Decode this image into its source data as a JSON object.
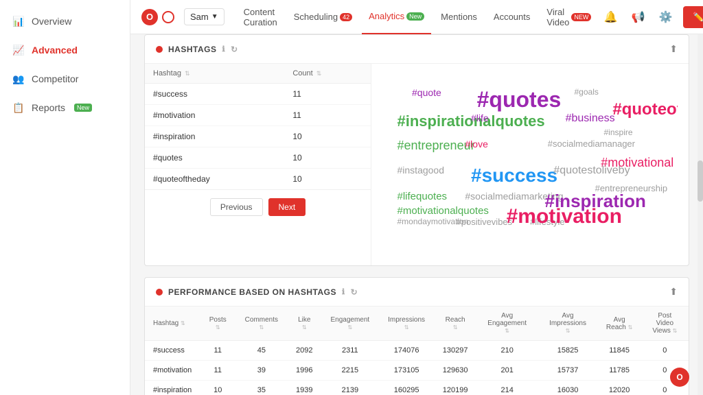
{
  "sidebar": {
    "items": [
      {
        "id": "overview",
        "label": "Overview",
        "icon": "📊",
        "active": false
      },
      {
        "id": "advanced",
        "label": "Advanced",
        "icon": "📈",
        "active": true
      },
      {
        "id": "competitor",
        "label": "Competitor",
        "icon": "👥",
        "active": false
      },
      {
        "id": "reports",
        "label": "Reports",
        "icon": "📋",
        "active": false,
        "badge": "New"
      }
    ]
  },
  "topnav": {
    "account": "Sam",
    "items": [
      {
        "id": "content-curation",
        "label": "Content Curation",
        "active": false
      },
      {
        "id": "scheduling",
        "label": "Scheduling",
        "active": false,
        "badge": "42"
      },
      {
        "id": "analytics",
        "label": "Analytics",
        "active": true,
        "badge": "New"
      },
      {
        "id": "mentions",
        "label": "Mentions",
        "active": false
      },
      {
        "id": "accounts",
        "label": "Accounts",
        "active": false
      },
      {
        "id": "viral-video",
        "label": "Viral Video",
        "active": false,
        "badge": "NEW"
      }
    ],
    "compose_label": "Compose"
  },
  "hashtags_card": {
    "title": "HASHTAGS",
    "table": {
      "columns": [
        "Hashtag",
        "Count"
      ],
      "rows": [
        {
          "hashtag": "#success",
          "count": "11"
        },
        {
          "hashtag": "#motivation",
          "count": "11"
        },
        {
          "hashtag": "#inspiration",
          "count": "10"
        },
        {
          "hashtag": "#quotes",
          "count": "10"
        },
        {
          "hashtag": "#quoteoftheday",
          "count": "10"
        }
      ]
    },
    "pagination": {
      "prev": "Previous",
      "next": "Next"
    },
    "wordcloud": [
      {
        "word": "#quote",
        "size": 14,
        "color": "#9c27b0"
      },
      {
        "word": "#quotes",
        "size": 32,
        "color": "#9c27b0"
      },
      {
        "word": "#goals",
        "size": 12,
        "color": "#9e9e9e"
      },
      {
        "word": "#inspirationalquotes",
        "size": 22,
        "color": "#4caf50"
      },
      {
        "word": "#life",
        "size": 14,
        "color": "#9c27b0"
      },
      {
        "word": "#business",
        "size": 16,
        "color": "#9c27b0"
      },
      {
        "word": "#entrepreneur",
        "size": 18,
        "color": "#4caf50"
      },
      {
        "word": "#love",
        "size": 14,
        "color": "#e91e63"
      },
      {
        "word": "#socialmediamanager",
        "size": 13,
        "color": "#9e9e9e"
      },
      {
        "word": "#instagood",
        "size": 14,
        "color": "#9e9e9e"
      },
      {
        "word": "#success",
        "size": 28,
        "color": "#2196f3"
      },
      {
        "word": "#quotestoliveby",
        "size": 16,
        "color": "#9e9e9e"
      },
      {
        "word": "#lifequotes",
        "size": 15,
        "color": "#4caf50"
      },
      {
        "word": "#socialmediamarketing",
        "size": 14,
        "color": "#9e9e9e"
      },
      {
        "word": "#inspiration",
        "size": 26,
        "color": "#9c27b0"
      },
      {
        "word": "#mondaymotivation",
        "size": 12,
        "color": "#9e9e9e"
      },
      {
        "word": "#positivevibes",
        "size": 13,
        "color": "#9e9e9e"
      },
      {
        "word": "#lifestyle",
        "size": 13,
        "color": "#9e9e9e"
      },
      {
        "word": "#quoteoftheday",
        "size": 24,
        "color": "#e91e63"
      },
      {
        "word": "#inspire",
        "size": 12,
        "color": "#9e9e9e"
      },
      {
        "word": "#motivational",
        "size": 18,
        "color": "#e91e63"
      },
      {
        "word": "#entrepreneurship",
        "size": 13,
        "color": "#9e9e9e"
      },
      {
        "word": "#motivationalquotes",
        "size": 15,
        "color": "#4caf50"
      },
      {
        "word": "#motivation",
        "size": 30,
        "color": "#e91e63"
      }
    ]
  },
  "performance_card": {
    "title": "PERFORMANCE BASED ON HASHTAGS",
    "columns": [
      "Hashtag",
      "Posts",
      "Comments",
      "Like",
      "Engagement",
      "Impressions",
      "Reach",
      "Avg Engagement",
      "Avg Impressions",
      "Avg Reach",
      "Post Video Views"
    ],
    "rows": [
      {
        "hashtag": "#success",
        "posts": "11",
        "comments": "45",
        "like": "2092",
        "engagement": "2311",
        "impressions": "174076",
        "reach": "130297",
        "avg_engagement": "210",
        "avg_impressions": "15825",
        "avg_reach": "11845",
        "post_video_views": "0"
      },
      {
        "hashtag": "#motivation",
        "posts": "11",
        "comments": "39",
        "like": "1996",
        "engagement": "2215",
        "impressions": "173105",
        "reach": "129630",
        "avg_engagement": "201",
        "avg_impressions": "15737",
        "avg_reach": "11785",
        "post_video_views": "0"
      },
      {
        "hashtag": "#inspiration",
        "posts": "10",
        "comments": "35",
        "like": "1939",
        "engagement": "2139",
        "impressions": "160295",
        "reach": "120199",
        "avg_engagement": "214",
        "avg_impressions": "16030",
        "avg_reach": "12020",
        "post_video_views": "0"
      }
    ]
  }
}
